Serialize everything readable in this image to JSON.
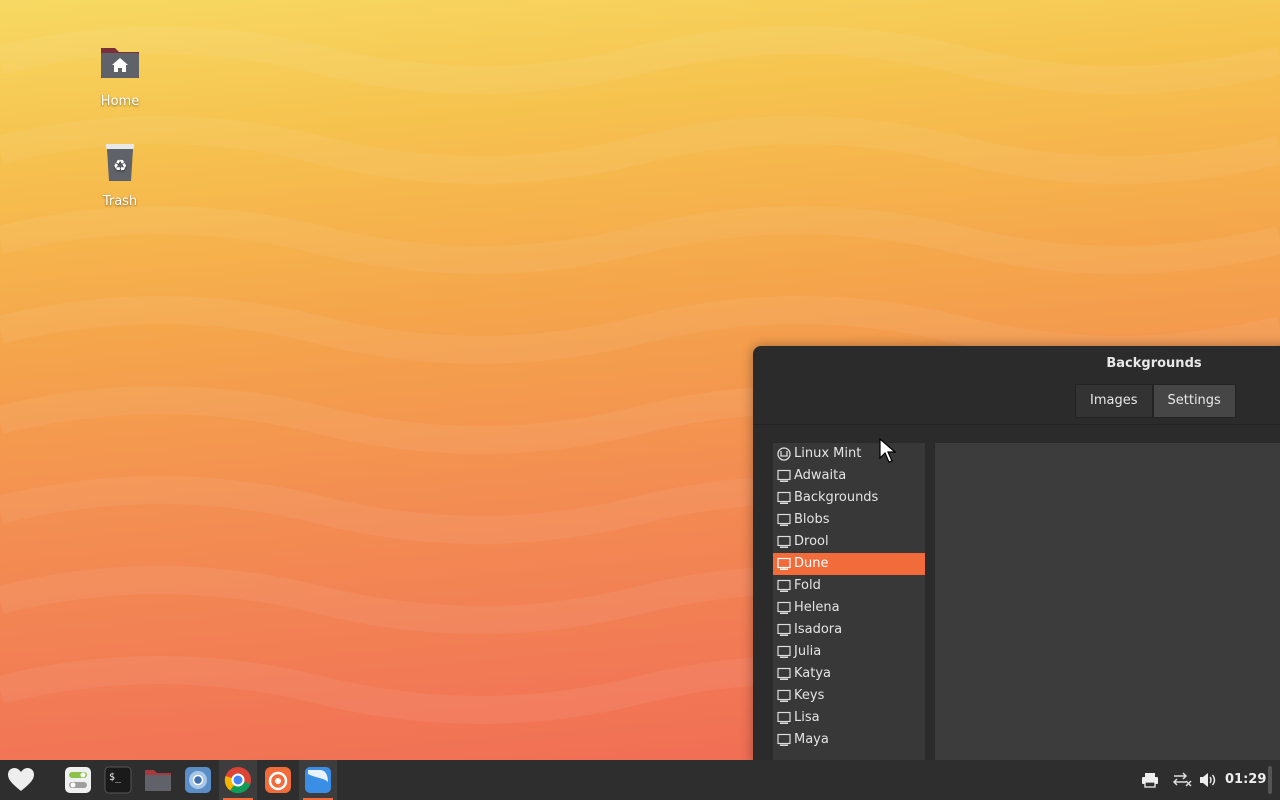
{
  "desktop": {
    "icons": [
      {
        "label": "Home",
        "icon": "home-folder-icon"
      },
      {
        "label": "Trash",
        "icon": "trash-icon"
      }
    ]
  },
  "window": {
    "title": "Backgrounds",
    "tabs": [
      {
        "label": "Images",
        "active": false
      },
      {
        "label": "Settings",
        "active": true
      }
    ],
    "collections": [
      {
        "label": "Linux Mint",
        "icon": "mint-logo-icon"
      },
      {
        "label": "Adwaita",
        "icon": "monitor-icon"
      },
      {
        "label": "Backgrounds",
        "icon": "monitor-icon"
      },
      {
        "label": "Blobs",
        "icon": "monitor-icon"
      },
      {
        "label": "Drool",
        "icon": "monitor-icon"
      },
      {
        "label": "Dune",
        "icon": "monitor-icon",
        "selected": true
      },
      {
        "label": "Fold",
        "icon": "monitor-icon"
      },
      {
        "label": "Helena",
        "icon": "monitor-icon"
      },
      {
        "label": "Isadora",
        "icon": "monitor-icon"
      },
      {
        "label": "Julia",
        "icon": "monitor-icon"
      },
      {
        "label": "Katya",
        "icon": "monitor-icon"
      },
      {
        "label": "Keys",
        "icon": "monitor-icon"
      },
      {
        "label": "Lisa",
        "icon": "monitor-icon"
      },
      {
        "label": "Maya",
        "icon": "monitor-icon"
      }
    ],
    "accent_color": "#f26b3a"
  },
  "taskbar": {
    "launchers": [
      "menu-heart-icon",
      "settings-toggle-icon",
      "terminal-icon",
      "files-icon",
      "chromium-icon",
      "chrome-icon",
      "firefox-icon",
      "backgrounds-app-icon"
    ],
    "tray": [
      "printer-icon",
      "network-disconnected-icon",
      "volume-icon"
    ],
    "clock": "01:29"
  }
}
